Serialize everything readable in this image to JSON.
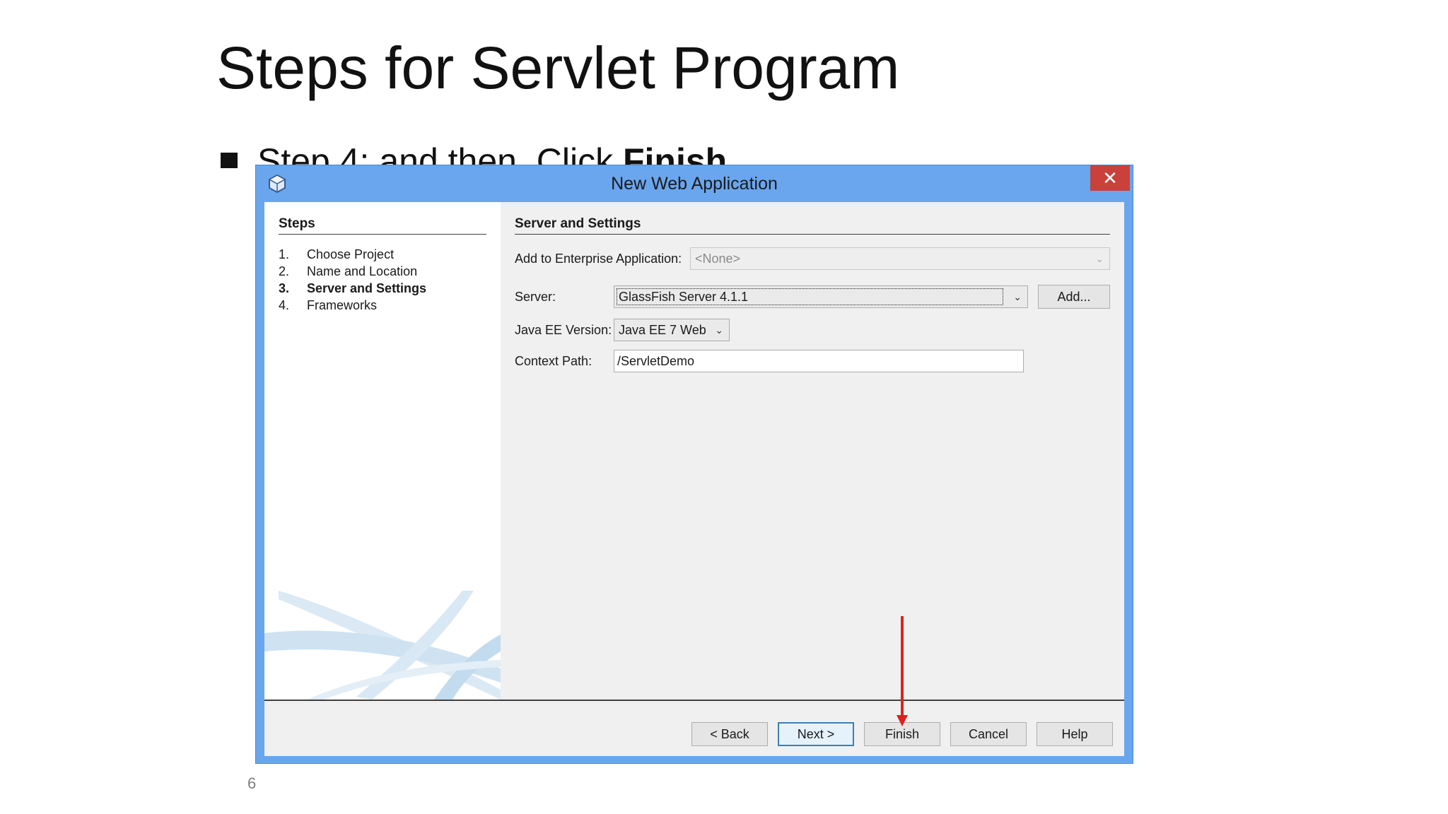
{
  "slide": {
    "title": "Steps for Servlet Program",
    "bullet_prefix": "Step 4: and then, Click ",
    "bullet_bold": "Finish",
    "page_number": "6"
  },
  "dialog": {
    "title": "New Web Application",
    "close_glyph": "✕",
    "steps": {
      "heading": "Steps",
      "items": [
        {
          "num": "1.",
          "label": "Choose Project"
        },
        {
          "num": "2.",
          "label": "Name and Location"
        },
        {
          "num": "3.",
          "label": "Server and Settings"
        },
        {
          "num": "4.",
          "label": "Frameworks"
        }
      ],
      "current_index": 2
    },
    "settings": {
      "heading": "Server and Settings",
      "enterprise_label": "Add to Enterprise Application:",
      "enterprise_value": "<None>",
      "server_label": "Server:",
      "server_value": "GlassFish Server 4.1.1",
      "add_button": "Add...",
      "javaee_label": "Java EE Version:",
      "javaee_value": "Java EE 7 Web",
      "context_label": "Context Path:",
      "context_value": "/ServletDemo"
    },
    "buttons": {
      "back": "< Back",
      "next": "Next >",
      "finish": "Finish",
      "cancel": "Cancel",
      "help": "Help"
    }
  },
  "colors": {
    "titlebar": "#6aa6ee",
    "close_button": "#c9413a",
    "annotation_arrow": "#e02020"
  }
}
